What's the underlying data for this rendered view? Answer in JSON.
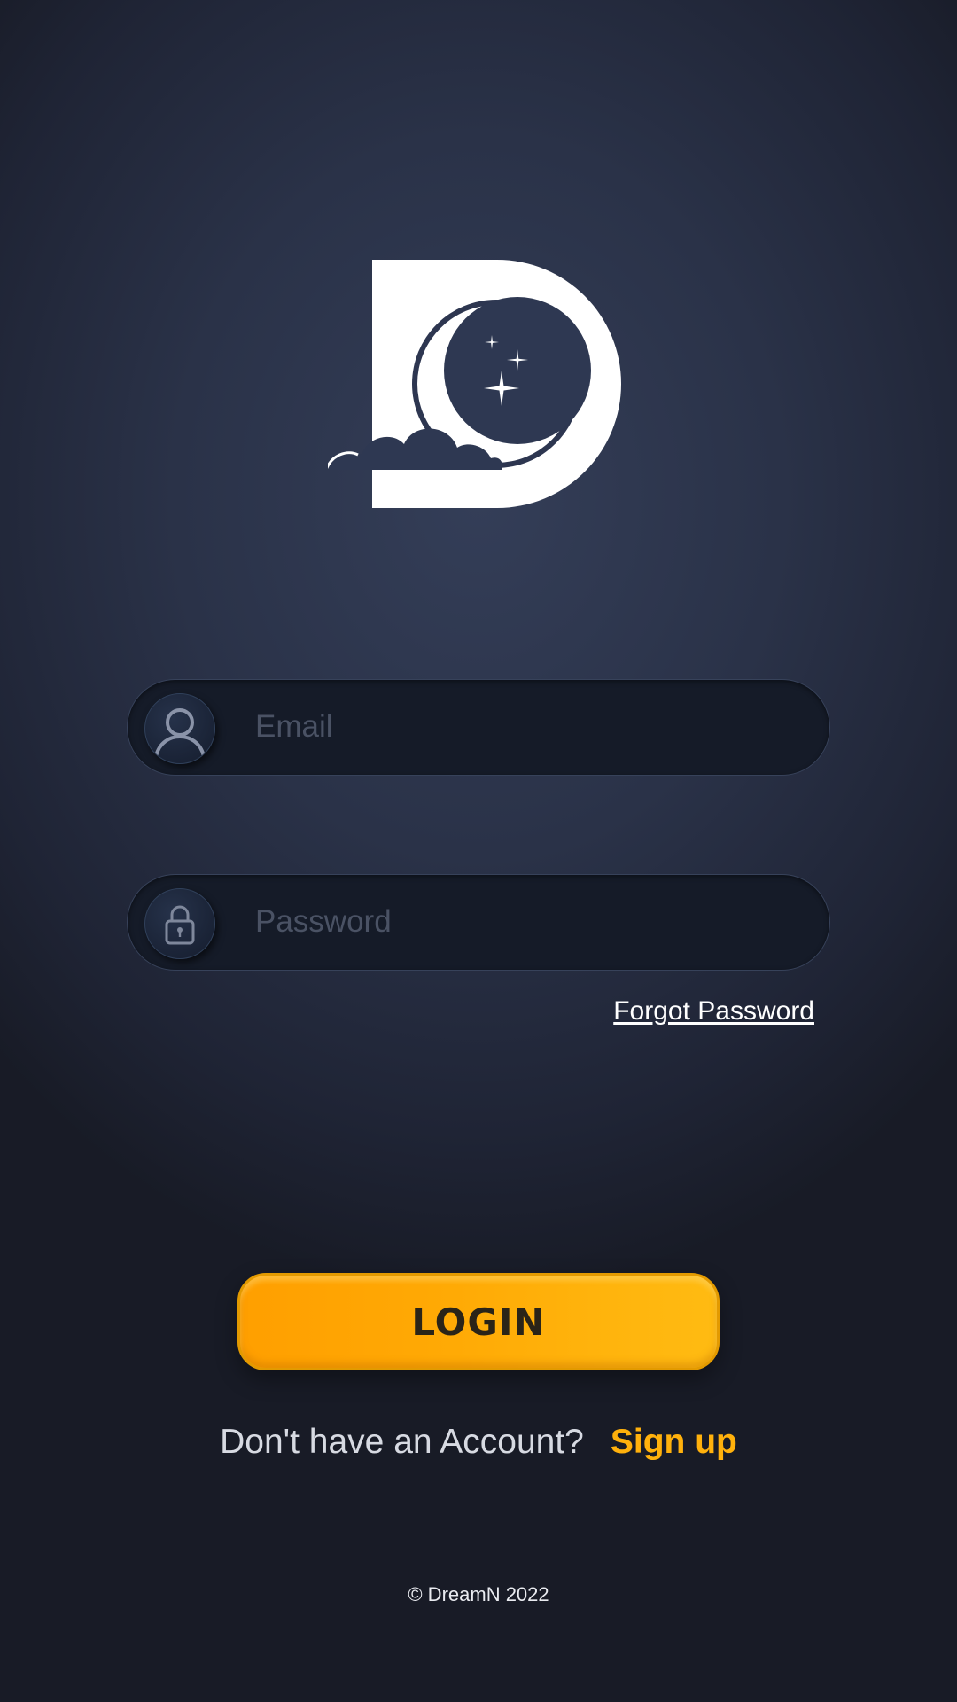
{
  "app": {
    "brand": "DreamN"
  },
  "logo": {
    "icon": "dreamn-logo-d-moon-cloud",
    "color": "#ffffff"
  },
  "form": {
    "email": {
      "placeholder": "Email",
      "value": "",
      "icon": "user-icon"
    },
    "password": {
      "placeholder": "Password",
      "value": "",
      "icon": "lock-icon"
    },
    "forgot_label": "Forgot Password"
  },
  "login": {
    "label": "LOGIN"
  },
  "signup": {
    "prompt": "Don't have an Account?",
    "link_label": "Sign up"
  },
  "footer": {
    "copyright": "© DreamN 2022"
  },
  "colors": {
    "accent": "#ffb10c",
    "background": "#2a3248",
    "field_background": "#151b28"
  }
}
